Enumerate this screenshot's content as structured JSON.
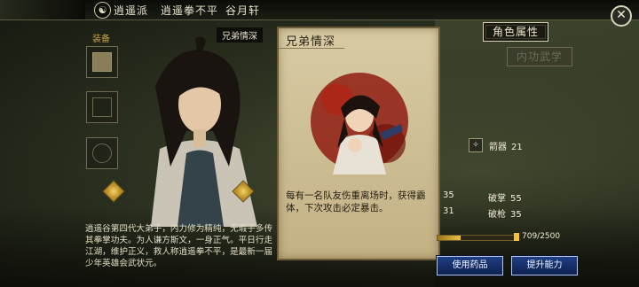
{
  "header": {
    "icon_glyph": "☯",
    "sect": "逍遥派",
    "martial_art": "逍遥拳不平",
    "location": "谷月轩",
    "close_glyph": "✕"
  },
  "equipment": {
    "label": "装备"
  },
  "character": {
    "name_tag": "兄弟情深",
    "bio": "逍遥谷第四代大弟子，内力修为精纯，无瑕子多传其拳掌功夫。为人谦方斯文，一身正气。平日行走江湖，维护正义，救人称逍遥拳不平，是最新一届少年英雄会武状元。"
  },
  "skill_card": {
    "title": "兄弟情深",
    "description": "每有一名队友伤重离场时，获得霸体，下次攻击必定暴击。"
  },
  "tabs": {
    "active": "角色属性",
    "inactive": "内功武学"
  },
  "stats": {
    "dart_icon": "✧",
    "dart_label": "箭器",
    "dart_value": "21",
    "row1_value": "35",
    "row2_value": "31",
    "palm_break_label": "破掌",
    "palm_break_value": "55",
    "spear_break_label": "破枪",
    "spear_break_value": "35"
  },
  "experience": {
    "text": "709/2500",
    "fraction": 0.2836
  },
  "buttons": {
    "use_medicine": "使用药品",
    "improve_ability": "提升能力"
  }
}
